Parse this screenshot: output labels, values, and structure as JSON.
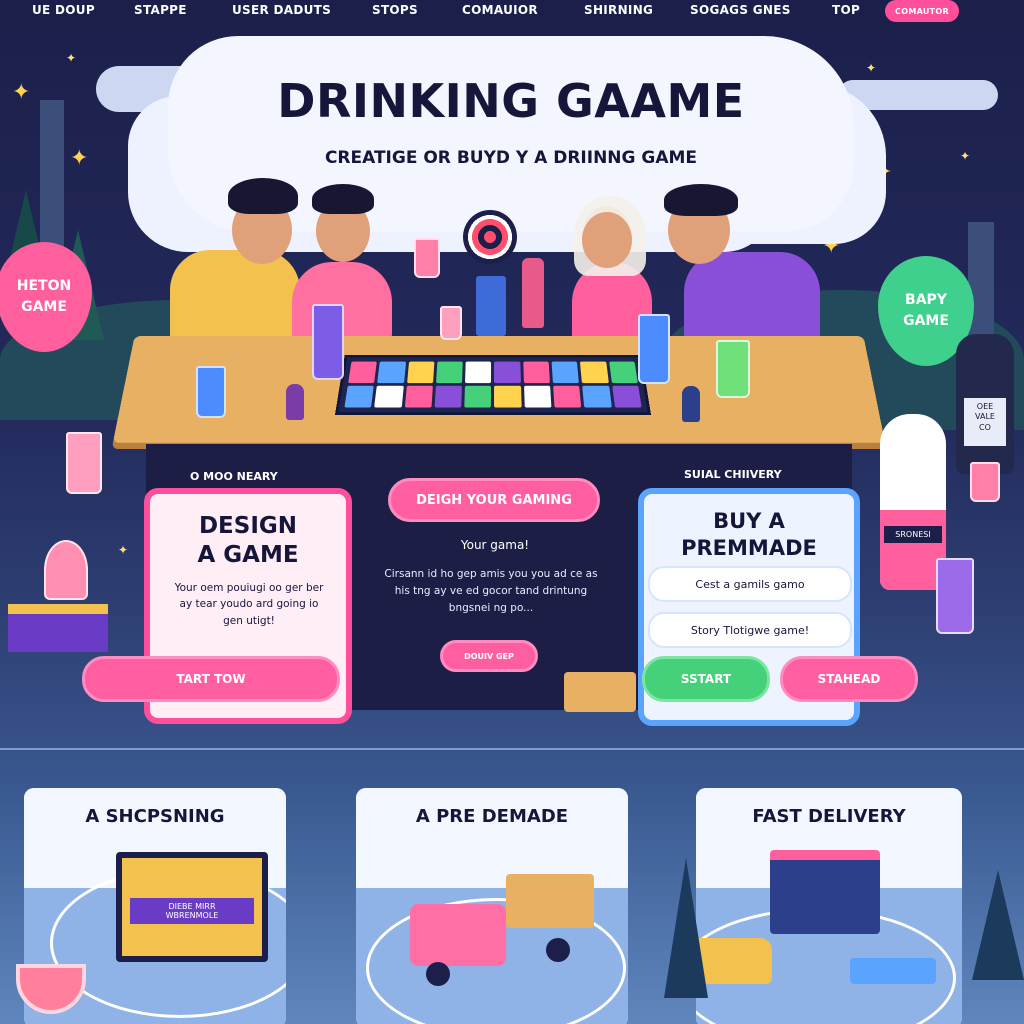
{
  "nav": {
    "items": [
      "UE DOUP",
      "STAPPE",
      "USER DADUTS",
      "STOPS",
      "COMAUIOR",
      "SHIRNING",
      "SOGAGS GNES",
      "TOP"
    ],
    "cta": "COMAUTOR"
  },
  "hero": {
    "title": "DRINKING GAAME",
    "subtitle": "CREATIGE OR BUYD Y A DRIINNG GAME"
  },
  "balloons": {
    "left": "HETON\nGAME",
    "right": "BAPY\nGAME"
  },
  "bottle_label": "OEE\nVALE\nCO",
  "bottle2_label": "SRONESI",
  "section_labels": {
    "left": "O MOO NEARY",
    "right": "SUIAL CHIIVERY"
  },
  "design_card": {
    "title": "DESIGN\nA GAME",
    "text": "Your oem pouiugi oo ger ber ay tear youdo ard going io gen utigt!",
    "button": "TART TOW"
  },
  "middle": {
    "button": "DEIGH YOUR GAMING",
    "heading": "Your gama!",
    "text": "Cirsann id ho gep amis you you ad ce as his tng ay ve ed gocor tand drintung bngsnei ng po...",
    "small_button": "DOUIV GEP"
  },
  "buy_card": {
    "title": "BUY A\nPREMMADE",
    "pill1": "Cest a gamils gamo",
    "pill2": "Story Tlotigwe game!",
    "button_start": "SSTART",
    "button_stahead": "STAHEAD"
  },
  "bottom_cards": [
    {
      "title": "A SHCPSNING",
      "truck_text": "DIEBE MIRR\nWBRENMOLE"
    },
    {
      "title": "A PRE DEMADE"
    },
    {
      "title": "FAST DELIVERY"
    }
  ],
  "colors": {
    "accent_pink": "#ff4f9a",
    "accent_blue": "#5aa3ff",
    "accent_green": "#45d07a",
    "night_sky": "#1b1f4a"
  }
}
